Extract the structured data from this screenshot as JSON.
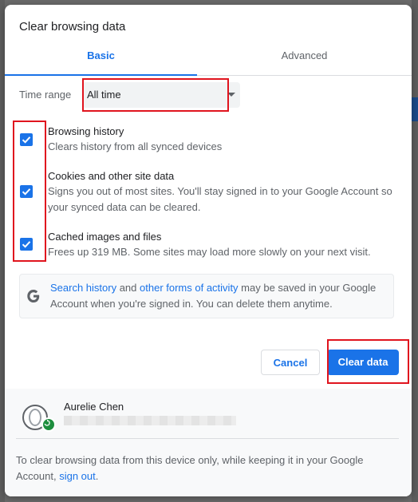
{
  "dialog": {
    "title": "Clear browsing data"
  },
  "tabs": [
    {
      "label": "Basic",
      "active": true
    },
    {
      "label": "Advanced",
      "active": false
    }
  ],
  "time_range": {
    "label": "Time range",
    "selected": "All time"
  },
  "options": [
    {
      "title": "Browsing history",
      "description": "Clears history from all synced devices",
      "checked": true
    },
    {
      "title": "Cookies and other site data",
      "description": "Signs you out of most sites. You'll stay signed in to your Google Account so your synced data can be cleared.",
      "checked": true
    },
    {
      "title": "Cached images and files",
      "description": "Frees up 319 MB. Some sites may load more slowly on your next visit.",
      "checked": true
    }
  ],
  "google_notice": {
    "link1": "Search history",
    "text1": " and ",
    "link2": "other forms of activity",
    "text2": " may be saved in your Google Account when you're signed in. You can delete them anytime."
  },
  "buttons": {
    "cancel": "Cancel",
    "clear": "Clear data"
  },
  "account": {
    "name": "Aurelie Chen"
  },
  "footer": {
    "text": "To clear browsing data from this device only, while keeping it in your Google Account, ",
    "link": "sign out",
    "end": "."
  },
  "colors": {
    "accent": "#1a73e8",
    "highlight": "#e0141e",
    "sync_green": "#1e8e3e"
  }
}
